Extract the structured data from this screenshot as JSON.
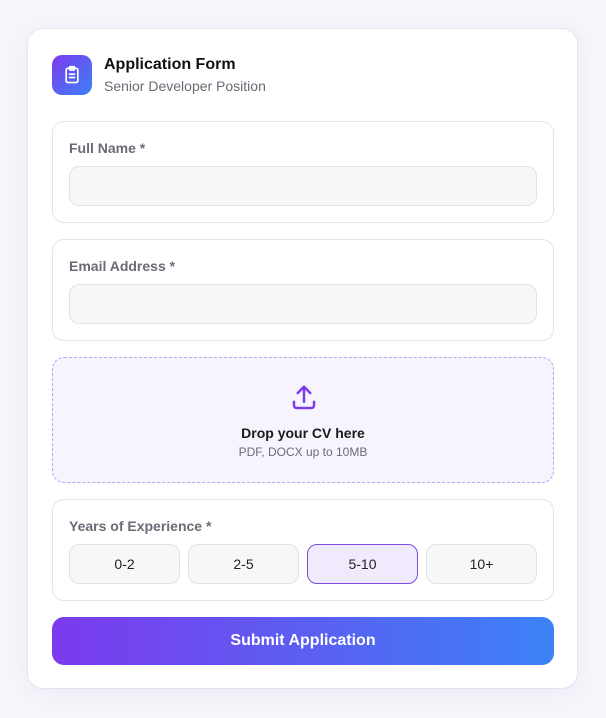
{
  "header": {
    "title": "Application Form",
    "subtitle": "Senior Developer Position",
    "icon": "clipboard-icon"
  },
  "fields": {
    "full_name": {
      "label": "Full Name *",
      "value": "",
      "placeholder": ""
    },
    "email": {
      "label": "Email Address *",
      "value": "",
      "placeholder": ""
    }
  },
  "upload": {
    "icon": "upload-icon",
    "title": "Drop your CV here",
    "hint": "PDF, DOCX up to 10MB"
  },
  "experience": {
    "label": "Years of Experience *",
    "options": [
      "0-2",
      "2-5",
      "5-10",
      "10+"
    ],
    "selected": "5-10"
  },
  "submit_label": "Submit Application",
  "colors": {
    "gradient_start": "#7c3aed",
    "gradient_end": "#3b82f6",
    "selected_border": "#7c4ddb",
    "selected_bg": "#f1eafd",
    "dropzone_bg": "#f8f4fe"
  }
}
